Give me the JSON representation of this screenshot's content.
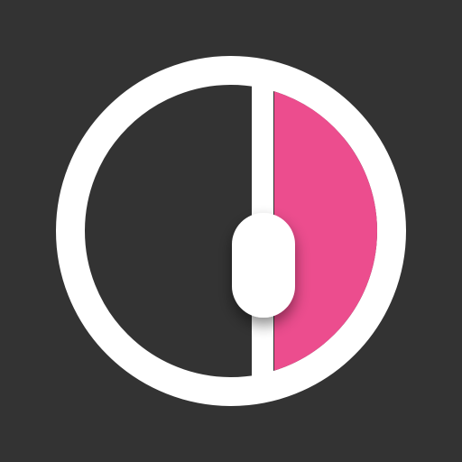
{
  "icon": {
    "name": "split-circle-slider-icon",
    "colors": {
      "background": "#333333",
      "ring": "#FFFFFF",
      "fill": "#EC4D8E",
      "handle": "#FFFFFF",
      "shadow": "#000000"
    }
  }
}
